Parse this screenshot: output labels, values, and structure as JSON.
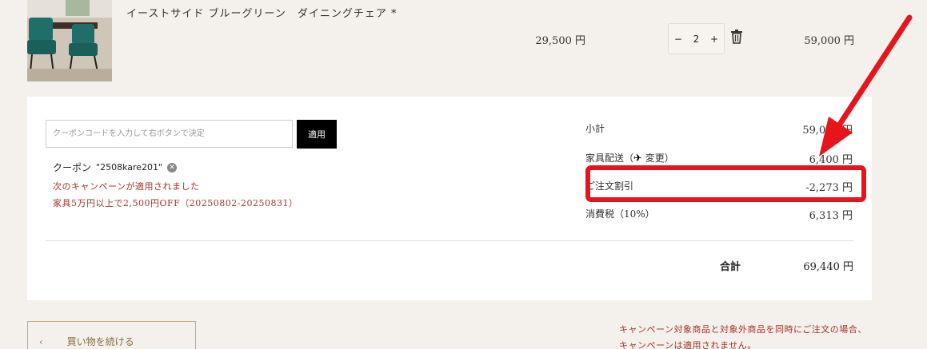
{
  "cart_item": {
    "name": "イーストサイド ブルーグリーン　ダイニングチェア *",
    "unit_price": "29,500 円",
    "quantity": "2",
    "minus": "−",
    "plus": "+",
    "line_total": "59,000 円",
    "image_icon": "dining-chair-photo"
  },
  "coupon": {
    "placeholder": "クーポンコードを入力して右ボタンで決定",
    "apply_label": "適用",
    "applied_prefix": "クーポン",
    "applied_code": "\"2508kare201\"",
    "remove_icon": "✕",
    "campaign_line1": "次のキャンペーンが適用されました",
    "campaign_line2": "家具5万円以上で2,500円OFF（20250802-20250831）"
  },
  "summary": {
    "subtotal_label": "小計",
    "subtotal_value": "59,000 円",
    "shipping_label": "家具配送（",
    "shipping_change": "変更）",
    "shipping_icon": "✈",
    "shipping_value": "6,400 円",
    "discount_label": "ご注文割引",
    "discount_value": "-2,273 円",
    "tax_label": "消費税（10%）",
    "tax_value": "6,313 円",
    "total_label": "合計",
    "total_value": "69,440 円"
  },
  "footer": {
    "continue_label": "買い物を続ける",
    "continue_icon": "‹",
    "campaign_note": "キャンペーン対象商品と対象外商品を同時にご注文の場合、キャンペーンは適用されません。"
  },
  "annotation": {
    "highlight_color": "#e8141b"
  }
}
